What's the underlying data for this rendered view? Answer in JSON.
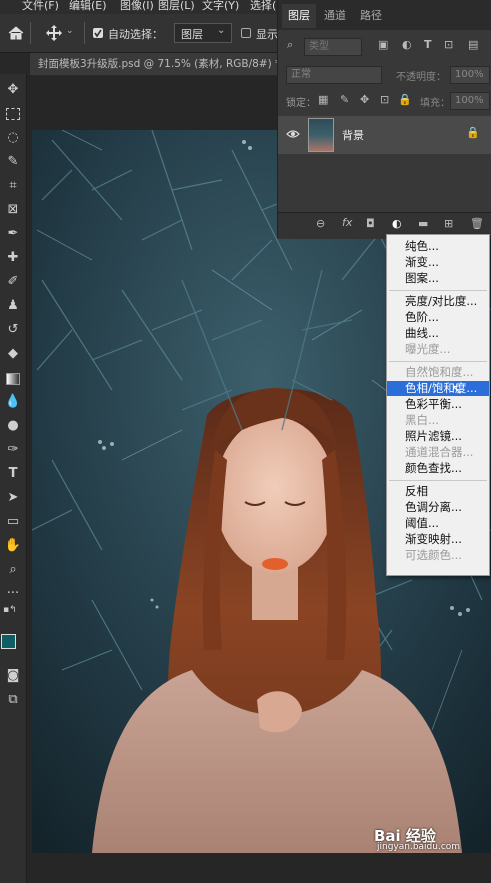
{
  "menubar": {
    "items": [
      "文件(F)",
      "编辑(E)",
      "图像(I)",
      "图层(L)",
      "文字(Y)",
      "选择("
    ]
  },
  "optionsbar": {
    "autoselect_label": "自动选择：",
    "autoselect_value": "图层",
    "show_label": "显示"
  },
  "document": {
    "tab_title": "封面模板3升级版.psd @ 71.5% (素材, RGB/8#) *"
  },
  "layers_panel": {
    "tabs": [
      "图层",
      "通道",
      "路径"
    ],
    "filter_placeholder": "类型",
    "blend_mode": "正常",
    "opacity_label": "不透明度：",
    "opacity_value": "100%",
    "lock_label": "锁定：",
    "fill_label": "填充：",
    "fill_value": "100%",
    "layer_name": "背景",
    "footer_icons": [
      "link-icon",
      "fx-icon",
      "mask-icon",
      "adjustment-icon",
      "folder-icon",
      "new-layer-icon",
      "trash-icon"
    ]
  },
  "adjust_menu": {
    "groups": [
      [
        {
          "label": "纯色...",
          "enabled": true
        },
        {
          "label": "渐变...",
          "enabled": true
        },
        {
          "label": "图案...",
          "enabled": true
        }
      ],
      [
        {
          "label": "亮度/对比度...",
          "enabled": true
        },
        {
          "label": "色阶...",
          "enabled": true
        },
        {
          "label": "曲线...",
          "enabled": true
        },
        {
          "label": "曝光度...",
          "enabled": false
        }
      ],
      [
        {
          "label": "自然饱和度...",
          "enabled": false
        },
        {
          "label": "色相/饱和度...",
          "enabled": true,
          "highlighted": true
        },
        {
          "label": "色彩平衡...",
          "enabled": true
        },
        {
          "label": "黑白...",
          "enabled": false
        },
        {
          "label": "照片滤镜...",
          "enabled": true
        },
        {
          "label": "通道混合器...",
          "enabled": false
        },
        {
          "label": "颜色查找...",
          "enabled": true
        }
      ],
      [
        {
          "label": "反相",
          "enabled": true
        },
        {
          "label": "色调分离...",
          "enabled": true
        },
        {
          "label": "阈值...",
          "enabled": true
        },
        {
          "label": "渐变映射...",
          "enabled": true
        },
        {
          "label": "可选颜色...",
          "enabled": false
        }
      ]
    ]
  },
  "toolbar": {
    "foreground_color": "#0f5e63",
    "background_color": "#1a2cd8"
  },
  "watermark": {
    "brand": "Bai 经验",
    "url": "jingyan.baidu.com"
  }
}
